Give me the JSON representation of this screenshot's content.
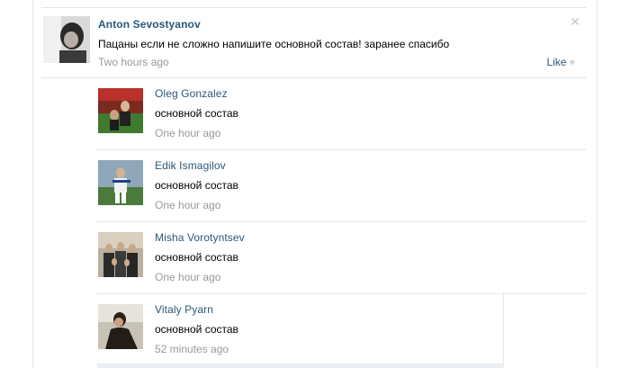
{
  "post": {
    "author": "Anton Sevostyanov",
    "text": "Пацаны если не сложно напишите основной состав! заранее спасибо",
    "time": "Two hours ago",
    "like_label": "Like",
    "close_glyph": "✕"
  },
  "replies": [
    {
      "author": "Oleg Gonzalez",
      "text": "основной состав",
      "time": "One hour ago"
    },
    {
      "author": "Edik Ismagilov",
      "text": "основной состав",
      "time": "One hour ago"
    },
    {
      "author": "Misha Vorotyntsev",
      "text": "основной состав",
      "time": "One hour ago"
    },
    {
      "author": "Vitaly Pyarn",
      "text": "основной состав",
      "time": "52 minutes ago"
    }
  ],
  "colors": {
    "link": "#2b587a",
    "muted": "#999999",
    "divider": "#dfe3e8"
  },
  "icons": {
    "close": "close-icon",
    "like": "heart-icon"
  }
}
